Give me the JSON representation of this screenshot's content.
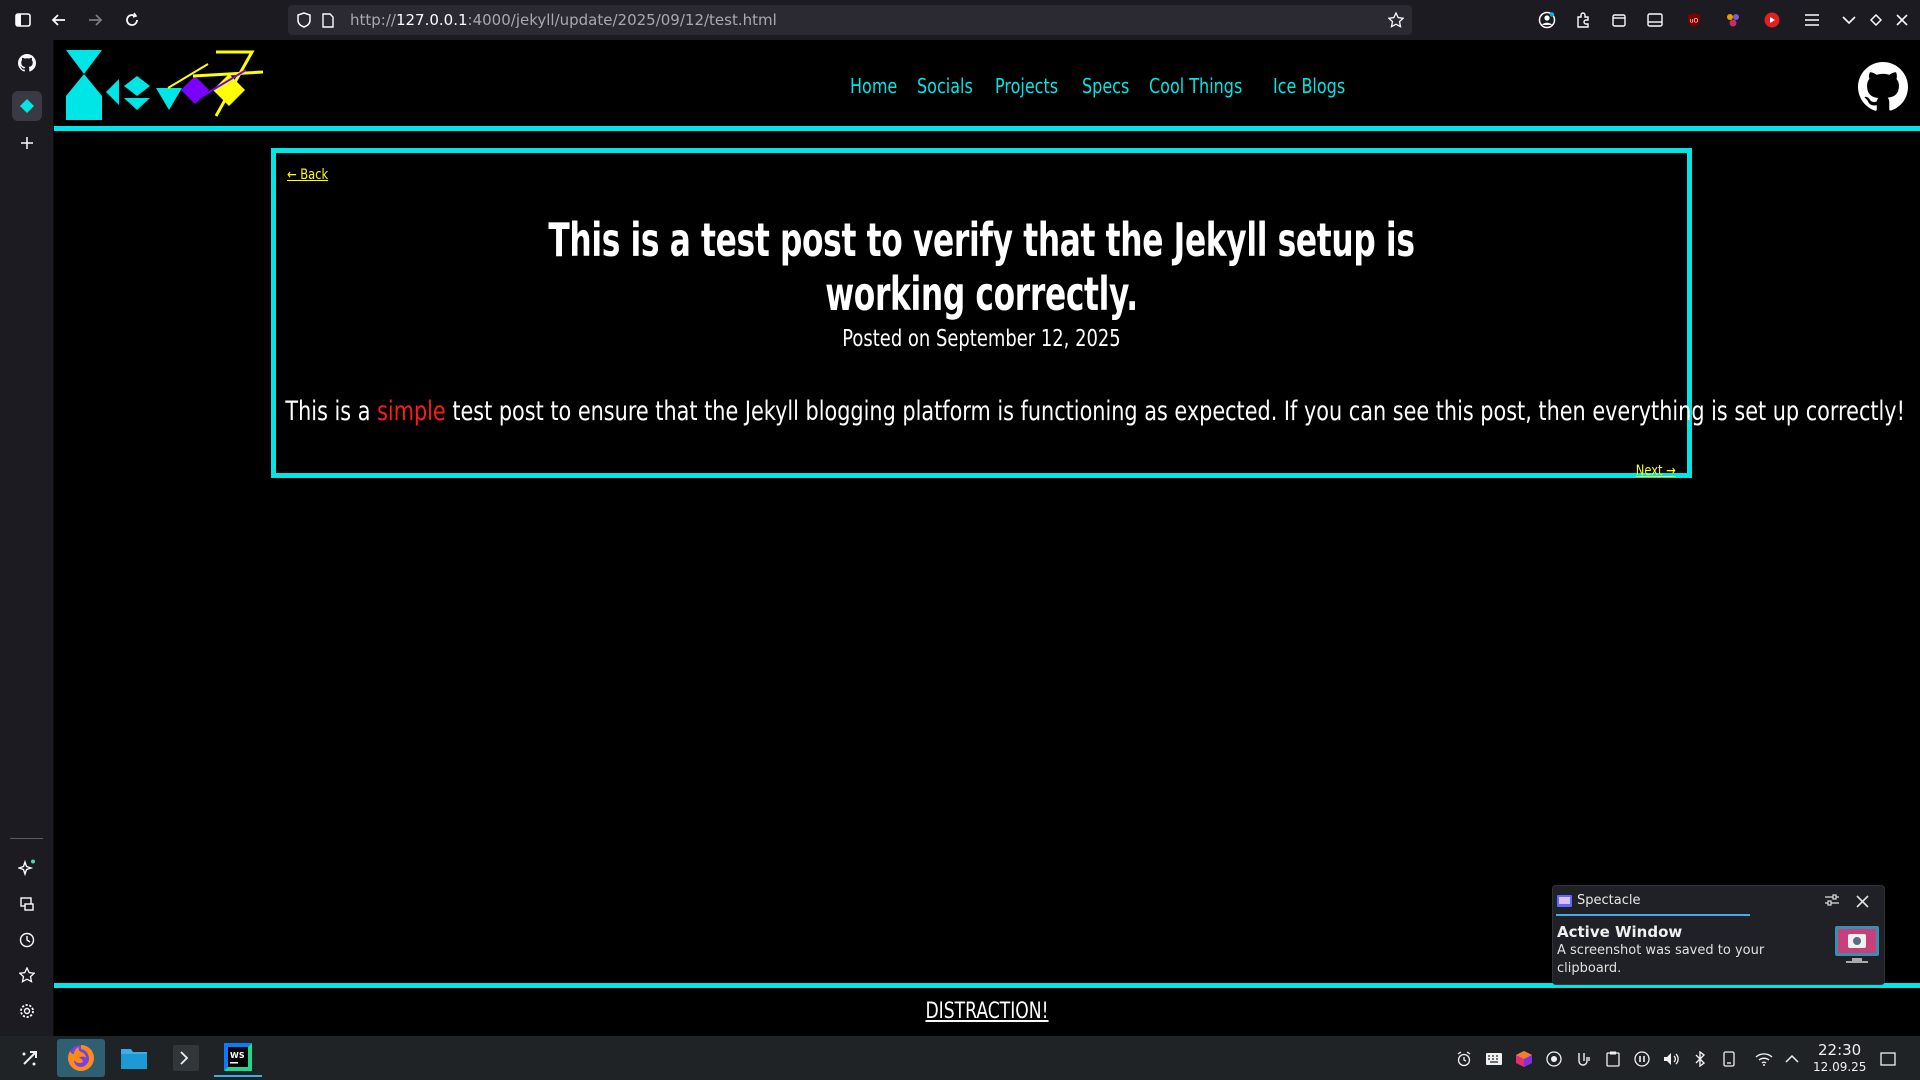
{
  "browser": {
    "url_prefix": "http://",
    "url_host": "127.0.0.1",
    "url_rest": ":4000/jekyll/update/2025/09/12/test.html"
  },
  "site": {
    "nav": [
      "Home",
      "Socials",
      "Projects",
      "Specs",
      "Cool Things",
      "Ice Blogs"
    ]
  },
  "post": {
    "back": "← Back",
    "title": "This is a test post to verify that the Jekyll setup is working correctly.",
    "date": "Posted on September 12, 2025",
    "body_before": "This is a ",
    "body_highlight": "simple",
    "body_after": " test post to ensure that the Jekyll blogging platform is functioning as expected. If you can see this post, then everything is set up correctly!",
    "next": "Next →"
  },
  "footer": {
    "link": "DISTRACTION!"
  },
  "notification": {
    "app": "Spectacle",
    "title": "Active Window",
    "text": "A screenshot was saved to your clipboard."
  },
  "clock": {
    "time": "22:30",
    "date": "12.09.25"
  },
  "colors": {
    "accent": "#00e5e5",
    "link": "#ffff00",
    "highlight": "#ff1a1a"
  }
}
